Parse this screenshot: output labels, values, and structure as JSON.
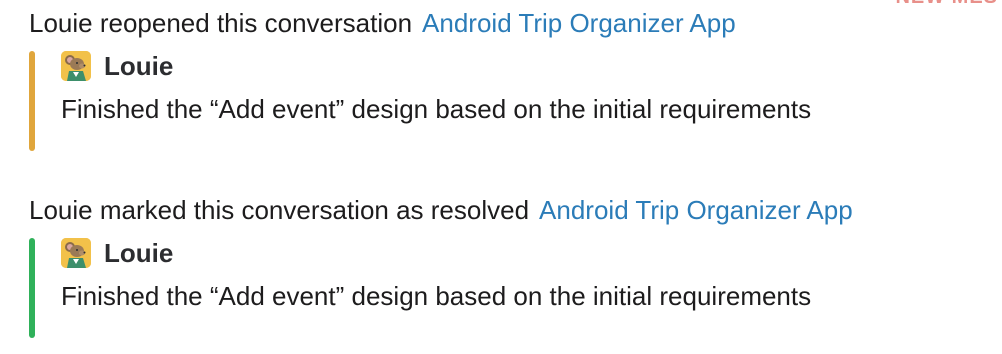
{
  "header_fragment": "NEW MES",
  "events": [
    {
      "text": "Louie reopened this conversation",
      "link": "Android Trip Organizer App",
      "author": "Louie",
      "message": "Finished the “Add event” design based on the initial requirements",
      "bar_color": "#e0a63c"
    },
    {
      "text": "Louie marked this conversation as resolved",
      "link": "Android Trip Organizer App",
      "author": "Louie",
      "message": "Finished the “Add event” design based on the initial requirements",
      "bar_color": "#2fb15a"
    }
  ],
  "avatar_icon": "mouse-character-avatar"
}
